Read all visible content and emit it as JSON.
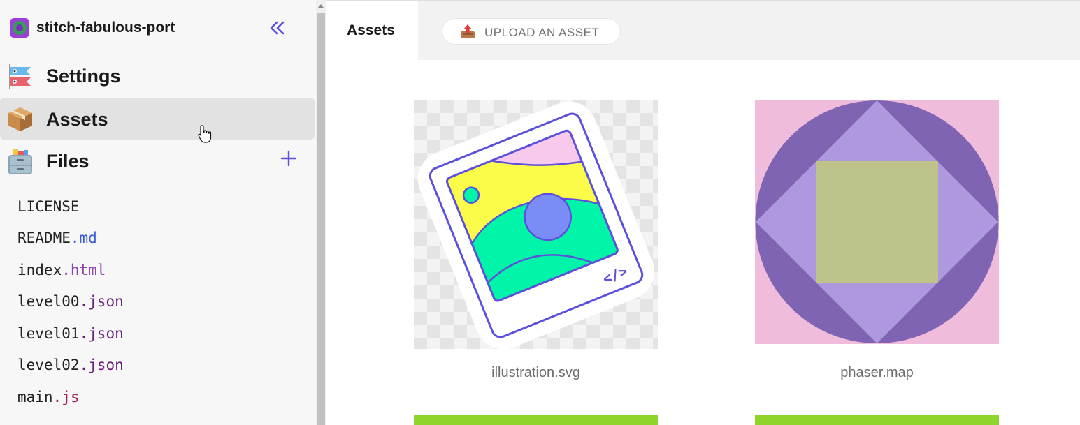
{
  "sidebar": {
    "project_name": "stitch-fabulous-port",
    "nav": [
      {
        "label": "Settings",
        "icon": "koinobori-flags-icon"
      },
      {
        "label": "Assets",
        "icon": "package-box-icon",
        "active": true
      },
      {
        "label": "Files",
        "icon": "file-cabinet-icon"
      }
    ],
    "files": [
      {
        "base": "LICENSE",
        "ext": ""
      },
      {
        "base": "README",
        "ext": ".md"
      },
      {
        "base": "index",
        "ext": ".html"
      },
      {
        "base": "level00",
        "ext": ".json"
      },
      {
        "base": "level01",
        "ext": ".json"
      },
      {
        "base": "level02",
        "ext": ".json"
      },
      {
        "base": "main",
        "ext": ".js"
      }
    ]
  },
  "main": {
    "tab_label": "Assets",
    "upload_label": "UPLOAD AN ASSET",
    "assets": [
      {
        "name": "illustration.svg"
      },
      {
        "name": "phaser.map"
      }
    ]
  },
  "colors": {
    "accent": "#5b4fdb",
    "active_nav_bg": "#e2e2e2",
    "green_asset": "#8fd42b"
  }
}
